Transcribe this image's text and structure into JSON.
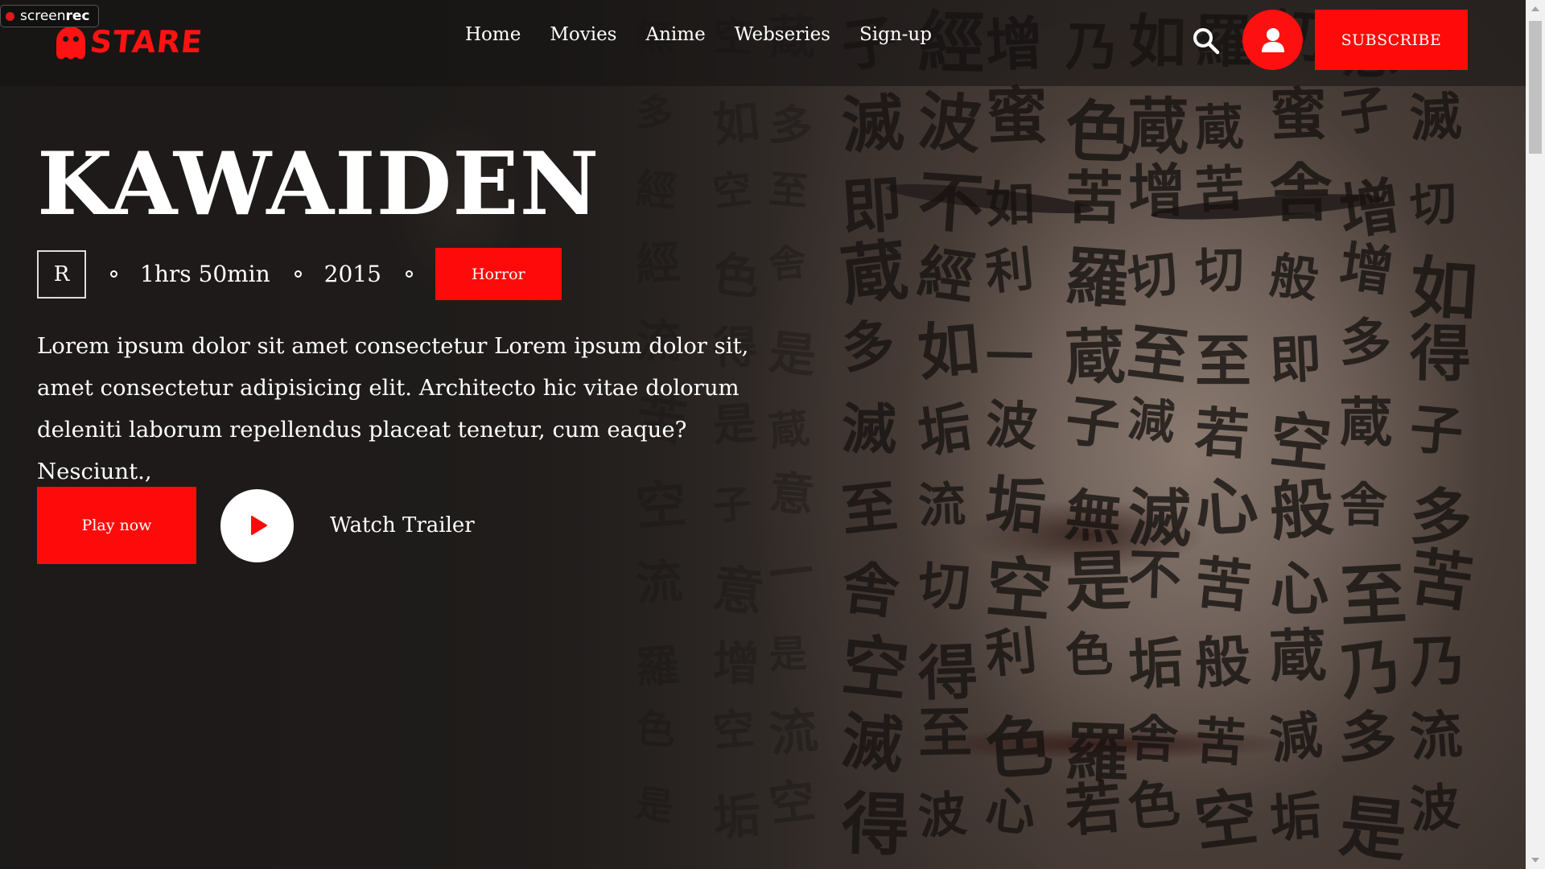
{
  "recorder": {
    "text_light": "screen",
    "text_bold": "rec"
  },
  "brand": {
    "name": "STARE",
    "accent": "#ff0a0a"
  },
  "nav": {
    "items": [
      "Home",
      "Movies",
      "Anime",
      "Webseries",
      "Sign-up"
    ]
  },
  "header": {
    "subscribe_label": "SUBSCRIBE"
  },
  "movie": {
    "title": "KAWAIDEN",
    "rating": "R",
    "duration": "1hrs 50min",
    "year": "2015",
    "genre": "Horror",
    "description": "Lorem ipsum dolor sit amet consectetur Lorem ipsum dolor sit, amet consectetur adipisicing elit. Architecto hic vitae dolorum deleniti laborum repellendus placeat tenetur, cum eaque? Nesciunt.,"
  },
  "actions": {
    "play_label": "Play now",
    "trailer_label": "Watch Trailer"
  },
  "icons": [
    "search-icon",
    "user-icon",
    "play-icon",
    "ghost-logo-icon"
  ]
}
